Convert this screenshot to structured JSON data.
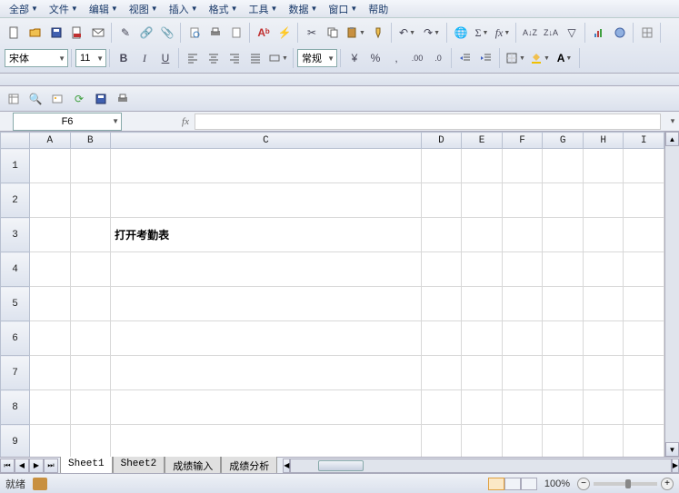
{
  "menubar": [
    {
      "label": "全部",
      "has_drop": true
    },
    {
      "label": "文件",
      "has_drop": true
    },
    {
      "label": "编辑",
      "has_drop": true
    },
    {
      "label": "视图",
      "has_drop": true
    },
    {
      "label": "插入",
      "has_drop": true
    },
    {
      "label": "格式",
      "has_drop": true
    },
    {
      "label": "工具",
      "has_drop": true
    },
    {
      "label": "数据",
      "has_drop": true
    },
    {
      "label": "窗口",
      "has_drop": true
    },
    {
      "label": "帮助"
    }
  ],
  "font": {
    "name": "宋体",
    "size": "11"
  },
  "number_format": "常规",
  "formula": {
    "cell_ref": "F6",
    "value": ""
  },
  "columns": [
    "",
    "A",
    "B",
    "C",
    "D",
    "E",
    "F",
    "G",
    "H",
    "I"
  ],
  "rows": [
    1,
    2,
    3,
    4,
    5,
    6,
    7,
    8,
    9
  ],
  "cell_content": {
    "3": {
      "C": "打开考勤表"
    }
  },
  "tabs": [
    "Sheet1",
    "Sheet2",
    "成绩输入",
    "成绩分析"
  ],
  "active_tab": 0,
  "status": "就绪",
  "zoom": "100%"
}
